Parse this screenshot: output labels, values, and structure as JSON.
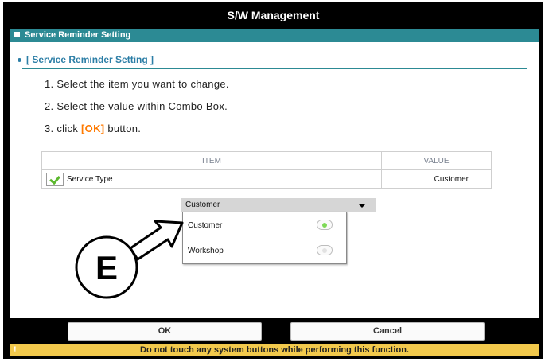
{
  "window": {
    "title": "S/W Management"
  },
  "subheader": {
    "title": "Service Reminder Setting"
  },
  "section": {
    "heading": "[ Service Reminder Setting ]"
  },
  "steps": {
    "step1": "1. Select the item you want to change.",
    "step2": "2. Select the value within Combo Box.",
    "step3_prefix": "3. click ",
    "step3_ok": "[OK]",
    "step3_suffix": " button."
  },
  "table": {
    "columns": [
      "ITEM",
      "VALUE"
    ],
    "rows": [
      {
        "item": "Service Type",
        "value": "Customer",
        "checked": true
      }
    ]
  },
  "combo": {
    "selected": "Customer",
    "options": [
      {
        "label": "Customer",
        "selected": true
      },
      {
        "label": "Workshop",
        "selected": false
      }
    ]
  },
  "callout": {
    "label": "E"
  },
  "buttons": {
    "ok": "OK",
    "cancel": "Cancel"
  },
  "footer": {
    "icon": "!",
    "message": "Do not touch any system buttons while performing this function."
  },
  "colors": {
    "accent": "#2c8a94",
    "ok_highlight": "#ff7a00",
    "radio_on": "#7ed957",
    "footer_bg": "#f2c94c"
  }
}
